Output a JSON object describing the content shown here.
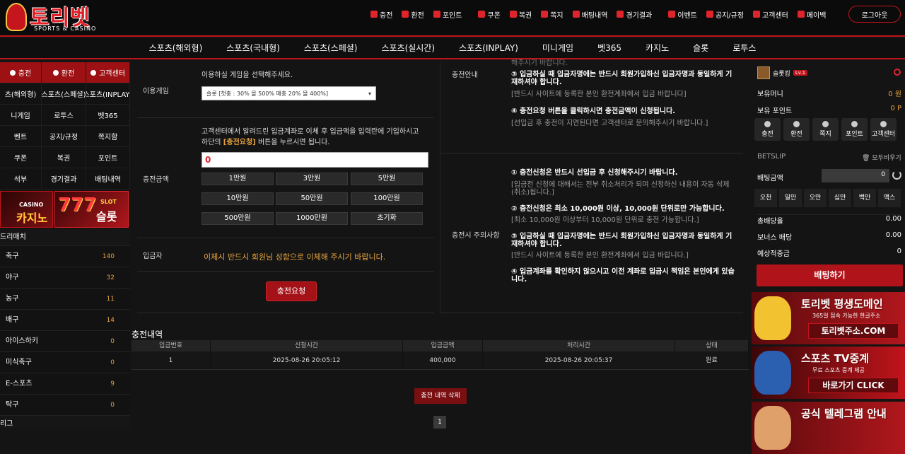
{
  "header": {
    "brand": "토리벳",
    "brand_sub": "SPORTS & CASINO",
    "logout": "로그아웃",
    "nav": [
      "충전",
      "환전",
      "포인트",
      "쿠폰",
      "복권",
      "쪽지",
      "배팅내역",
      "경기결과",
      "이벤트",
      "공지/규정",
      "고객센터",
      "페이백"
    ]
  },
  "mainnav": [
    "스포츠(해외형)",
    "스포츠(국내형)",
    "스포츠(스페셜)",
    "스포츠(실시간)",
    "스포츠(INPLAY)",
    "미니게임",
    "벳365",
    "카지노",
    "슬롯",
    "로투스"
  ],
  "left": {
    "grid": [
      "충전",
      "환전",
      "고객센터",
      "츠(해외형)",
      "스포츠(스페셜)",
      "스포츠(INPLAY)",
      "니게임",
      "로투스",
      "벳365",
      "벤트",
      "공지/규정",
      "쪽지함",
      "쿠폰",
      "복권",
      "포인트",
      "석부",
      "경기결과",
      "배팅내역"
    ],
    "casino_small": "CASINO",
    "casino_big": "카지노",
    "slot_small": "SLOT",
    "slot_big": "슬롯",
    "slot_sevens": "777",
    "section_title": "드리매치",
    "section_bottom": "리그",
    "sports": [
      {
        "name": "축구",
        "count": "140"
      },
      {
        "name": "야구",
        "count": "32"
      },
      {
        "name": "농구",
        "count": "11"
      },
      {
        "name": "배구",
        "count": "14"
      },
      {
        "name": "아이스하키",
        "count": "0"
      },
      {
        "name": "미식축구",
        "count": "0"
      },
      {
        "name": "E-스포츠",
        "count": "9"
      },
      {
        "name": "탁구",
        "count": "0"
      }
    ]
  },
  "form": {
    "game_label": "이용게임",
    "game_instruction": "이용하실 게임을 선택해주세요.",
    "game_option": "슬롯 [첫충 : 30% 몰 500% 매충 20% 몰 400%]",
    "amount_label": "충전금액",
    "amount_desc1": "고객센터에서 알려드린 입금계좌로 이체 후 입금액을 입력란에 기입하시고",
    "amount_desc2_pre": "하단의",
    "amount_desc2_em": "[충전요청]",
    "amount_desc2_post": "버튼을 누르시면 됩니다.",
    "amount_value": "0",
    "amounts": [
      "1만원",
      "3만원",
      "5만원",
      "10만원",
      "50만원",
      "100만원",
      "500만원",
      "1000만원",
      "초기화"
    ],
    "depositor_label": "입금자",
    "depositor_note": "이체시 반드시 회원님 성함으로 이체해 주시기 바랍니다.",
    "request_button": "충전요청"
  },
  "info": {
    "top_cut": "해주시기 바랍니다.",
    "guide_label": "충전안내",
    "caution_label": "충전시 주의사항",
    "guide": [
      {
        "b": "③ 입금하실 때 입금자명에는 반드시 회원가입하신 입금자명과 동일하게 기",
        "b2": "재하셔야 합니다.",
        "g": "[반드시 사이트에 등록한 본인 환전계좌에서 입금 바랍니다]"
      },
      {
        "b": "④ 충전요청 버튼을 클릭하시면 충전금액이 신청됩니다.",
        "g": "[선입금 후 충전이 지연된다면 고객센터로 문의해주시기 바랍니다.]"
      }
    ],
    "caution": [
      {
        "b": "① 충전신청은 반드시 선입금 후 신청해주시기 바랍니다.",
        "g": "[입금전 신청에 대해서는 전부 취소처리가 되며 신청하신 내용이 자동 삭제",
        "g2": "(취소)됩니다.]"
      },
      {
        "b": "② 충전신청은 최소 10,000원 이상, 10,000원 단위로만 가능합니다.",
        "g": "[최소 10,000원 이상부터 10,000원 단위로 충전 가능합니다.]"
      },
      {
        "b": "③ 입금하실 때 입금자명에는 반드시 회원가입하신 입금자명과 동일하게 기",
        "b2": "재하셔야 합니다.",
        "g": "[반드시 사이트에 등록한 본인 환전계좌에서 입금 바랍니다.]"
      },
      {
        "b": "④ 입금계좌를 확인하지 않으시고 이전 계좌로 입금시 책임은 본인에게 있습",
        "b2": "니다."
      }
    ]
  },
  "history": {
    "title": "충전내역",
    "headers": [
      "입금번호",
      "신청시간",
      "입금금액",
      "처리시간",
      "상태"
    ],
    "rows": [
      [
        "1",
        "2025-08-26 20:05:12",
        "400,000",
        "2025-08-26 20:05:37",
        "완료"
      ]
    ],
    "delete": "충전 내역 삭제",
    "page": "1"
  },
  "right": {
    "username": "슬롯킹",
    "level": "Lv.1",
    "money_label": "보유머니",
    "money": "0 원",
    "point_label": "보유 포인트",
    "point": "0 P",
    "buttons": [
      "충전",
      "환전",
      "쪽지",
      "포인트",
      "고객센터"
    ],
    "betslip": "BETSLIP",
    "clear_all": "모두비우기",
    "bet_amount_label": "배팅금액",
    "bet_amount": "0",
    "chips": [
      "오천",
      "일만",
      "오만",
      "십만",
      "백만",
      "맥스"
    ],
    "stats": [
      {
        "k": "총배당율",
        "v": "0.00"
      },
      {
        "k": "보너스 배당",
        "v": "0.00"
      },
      {
        "k": "예상적중금",
        "v": "0"
      }
    ],
    "bet_button": "배팅하기",
    "ads": [
      {
        "h": "토리벳 평생도메인",
        "s": "365일 접속 가능한 한글주소",
        "u": "토리벳주소.COM"
      },
      {
        "h": "스포츠 TV중계",
        "s": "무료 스포츠 중계 제공",
        "u": "바로가기 CLICK"
      },
      {
        "h": "공식 텔레그램 안내",
        "s": "",
        "u": ""
      }
    ]
  },
  "colors": {
    "accent": "#c0141b",
    "bg": "#141414",
    "highlight": "#e6a23c"
  }
}
